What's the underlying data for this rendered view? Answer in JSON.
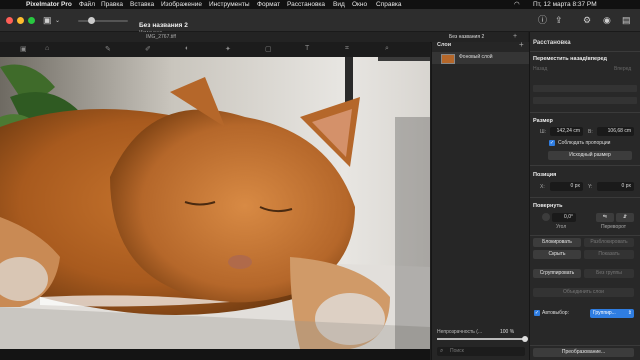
{
  "menubar": {
    "app_name": "Pixelmator Pro",
    "items": [
      "Файл",
      "Правка",
      "Вставка",
      "Изображение",
      "Инструменты",
      "Формат",
      "Расстановка",
      "Вид",
      "Окно",
      "Справка"
    ],
    "clock": "Пт, 12 марта  8:37 PM",
    "colors": {
      "bg": "#111111"
    }
  },
  "toolbar": {
    "title": "Без названия 2",
    "subtitle": "Изменено",
    "icons": [
      "sidebar-toggle-icon",
      "zoom-slider-icon",
      "info-icon",
      "share-icon",
      "tools-icon",
      "search-icon",
      "user-icon",
      "menu-icon"
    ]
  },
  "tabs": {
    "items": [
      "IMG_2767.tiff"
    ],
    "active": "Без названия 2"
  },
  "layers": {
    "title": "Слои",
    "add_label": "+",
    "items": [
      {
        "name": "Фоновый слой"
      }
    ],
    "opacity_label": "Непрозрачность (...",
    "opacity_value": "100 %",
    "opacity_level": 1.0,
    "search_placeholder": "Поиск"
  },
  "arrange": {
    "title": "Расстановка",
    "move_section": "Переместить назад/вперед",
    "move_back": "Назад",
    "move_forward": "Вперед",
    "size_section": "Размер",
    "width_label": "Ш:",
    "width_value": "142,24 cm",
    "height_label": "В:",
    "height_value": "106,68 cm",
    "keep_ratio": "Соблюдать пропорции",
    "original_size": "Исходный размер",
    "position_section": "Позиция",
    "x_label": "X:",
    "x_value": "0 px",
    "y_label": "Y:",
    "y_value": "0 px",
    "rotate_section": "Повернуть",
    "angle_value": "0,0°",
    "angle_label": "Угол",
    "flip_label": "Переворот",
    "lock": "Блокировать",
    "unlock": "Разблокировать",
    "hide": "Скрыть",
    "show": "Показать",
    "group": "Сгруппировать",
    "ungroup": "Без группы",
    "merge": "Объединить слои",
    "autoselect": "Автовыбор:",
    "autoselect_value": "Группир...",
    "transform": "Преобразование..."
  }
}
